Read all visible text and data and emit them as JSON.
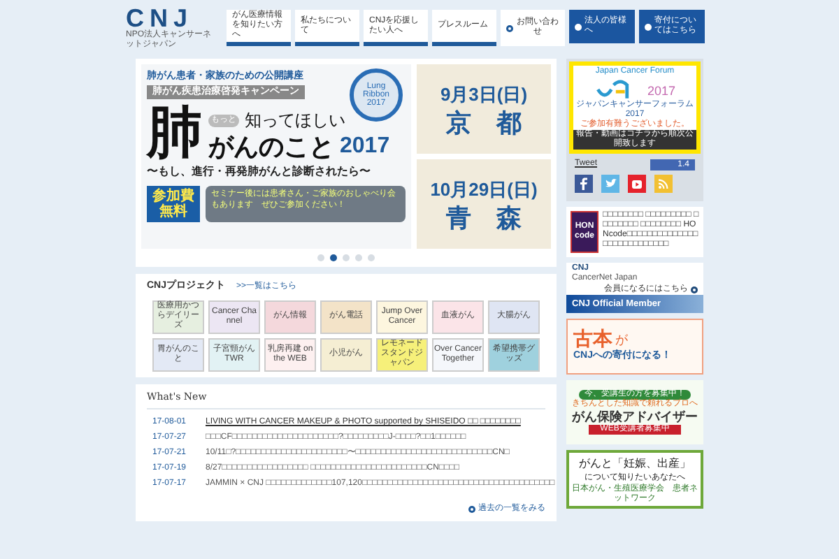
{
  "logo": {
    "mark": "CNJ",
    "subtitle": "NPO法人キャンサーネットジャパン"
  },
  "nav": [
    {
      "label": "がん医療情報を知りたい方へ",
      "kind": "tab"
    },
    {
      "label": "私たちについて",
      "kind": "tab"
    },
    {
      "label": "CNJを応援したい人へ",
      "kind": "tab"
    },
    {
      "label": "プレスルーム",
      "kind": "tab"
    },
    {
      "label": "お問い合わせ",
      "kind": "plain"
    },
    {
      "label": "法人の皆様へ",
      "kind": "dark"
    },
    {
      "label": "寄付についてはこちら",
      "kind": "dark"
    }
  ],
  "hero": {
    "lead": "肺がん患者・家族のための公開講座",
    "campaign": "肺がん疾患治療啓発キャンペーン",
    "ribbon": "Lung Ribbon 2017",
    "motto": "もっと",
    "title_small": "知ってほしい",
    "title_big": "肺",
    "title_mid": "がんのこと",
    "year": "2017",
    "subtitle": "〜もし、進行・再発肺がんと診断されたら〜",
    "free": "参加費無料",
    "note": "セミナー後には患者さん・ご家族のおしゃべり会もあります　ぜひご参加ください！",
    "events": [
      {
        "date": "9月3日(日)",
        "city": "京　都"
      },
      {
        "date": "10月29日(日)",
        "city": "青　森"
      }
    ],
    "dots": [
      {
        "selected": false
      },
      {
        "selected": true
      },
      {
        "selected": false
      },
      {
        "selected": false
      },
      {
        "selected": false
      }
    ]
  },
  "projects": {
    "title": "CNJプロジェクト",
    "link": ">>一覧はこちら",
    "tiles": [
      {
        "label": "医療用かつらデイリーズ",
        "color": "#e6efe0"
      },
      {
        "label": "Cancer Channel",
        "color": "#ece6f3"
      },
      {
        "label": "がん情報",
        "color": "#f4d8dc"
      },
      {
        "label": "がん電話",
        "color": "#f3e3c8"
      },
      {
        "label": "Jump Over Cancer",
        "color": "#fdf6df"
      },
      {
        "label": "血液がん",
        "color": "#fbe4e8"
      },
      {
        "label": "大腸がん",
        "color": "#dfe5f3"
      },
      {
        "label": "胃がんのこと",
        "color": "#e3e9f5"
      },
      {
        "label": "子宮頸がん TWR",
        "color": "#e2f2f4"
      },
      {
        "label": "乳房再建 on the WEB",
        "color": "#fdf0f0"
      },
      {
        "label": "小児がん",
        "color": "#f5eed3"
      },
      {
        "label": "レモネードスタンドジャパン",
        "color": "#f6f07a"
      },
      {
        "label": "Over Cancer Together",
        "color": "#f5f7fb"
      },
      {
        "label": "希望携帯グッズ",
        "color": "#9fd1de"
      }
    ]
  },
  "news": {
    "title": "What's New",
    "more": "過去の一覧をみる",
    "items": [
      {
        "date": "17-08-01",
        "text": "LIVING WITH CANCER MAKEUP & PHOTO supported by SHISEIDO □□ □□□□□□□□",
        "link": true
      },
      {
        "date": "17-07-27",
        "text": "□□□CF□□□□□□□□□□□□□□□□□□□□□?□□□□□□□□□J-□□□□?□□1□□□□□□",
        "link": false
      },
      {
        "date": "17-07-21",
        "text": "10/11□?□□□□□□□□□□□□□□□□□□□□□□〜□□□□□□□□□□□□□□□□□□□□□□□□□□□CN□",
        "link": false
      },
      {
        "date": "17-07-19",
        "text": "8/27□□□□□□□□□□□□□□□□□ □□□□□□□□□□□□□□□□□□□□□□□CN□□□□",
        "link": false
      },
      {
        "date": "17-07-17",
        "text": "JAMMIN × CNJ □□□□□□□□□□□□□107,120□□□□□□□□□□□□□□□□□□□□□□□□□□□□□□□□□□□□□□",
        "link": false
      }
    ]
  },
  "sidebar": {
    "forum": {
      "title": "Japan Cancer Forum",
      "year": "2017",
      "sub": "ジャパンキャンサーフォーラム2017",
      "thanks": "ご参加有難うございました。",
      "info": "報告・動画はコチラから順次公開致します"
    },
    "tweet": "Tweet",
    "likes": "1.4",
    "hon": {
      "badge": "HON code",
      "text": "□□□□□□□□ □□□□□□□□□ □□□□□□□□ □□□□□□□□ HONcode□□□□□□□□□□□□□□□□□□□□□□□□□□□"
    },
    "member": {
      "logo": "CNJ",
      "logo_sub": "CancerNet Japan",
      "join": "会員になるにはこちら",
      "title": "CNJ Official Member"
    },
    "banners": [
      {
        "kind": "books",
        "big": "古本",
        "mid": "が",
        "small": "CNJへの寄付になる！"
      },
      {
        "kind": "advisor",
        "top": "今、受講生の方を募集中！",
        "lead": "きちんとした知識で頼れるプロへ",
        "big": "がん保険アドバイザー",
        "ribbon": "WEB受講者募集中"
      },
      {
        "kind": "pregnancy",
        "big": "がんと「妊娠、出産」",
        "mid": "について知りたいあなたへ",
        "small": "日本がん・生殖医療学会　患者ネットワーク"
      }
    ]
  }
}
